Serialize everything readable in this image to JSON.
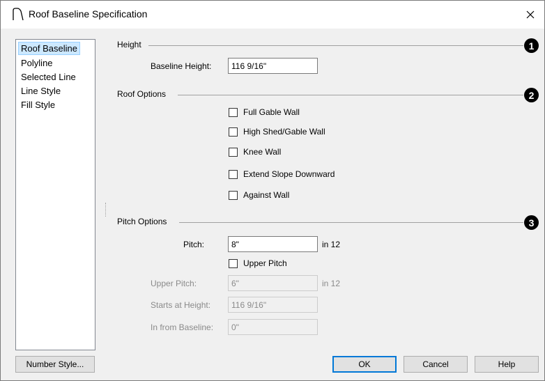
{
  "window": {
    "title": "Roof Baseline Specification"
  },
  "nav": {
    "items": [
      {
        "label": "Roof Baseline",
        "selected": true
      },
      {
        "label": "Polyline",
        "selected": false
      },
      {
        "label": "Selected Line",
        "selected": false
      },
      {
        "label": "Line Style",
        "selected": false
      },
      {
        "label": "Fill Style",
        "selected": false
      }
    ]
  },
  "height": {
    "group_label": "Height",
    "callout": "1",
    "baseline_height_label": "Baseline Height:",
    "baseline_height_value": "116 9/16\""
  },
  "roof_options": {
    "group_label": "Roof Options",
    "callout": "2",
    "checkboxes": [
      {
        "label": "Full Gable Wall",
        "checked": false
      },
      {
        "label": "High Shed/Gable Wall",
        "checked": false
      },
      {
        "label": "Knee Wall",
        "checked": false
      },
      {
        "label": "Extend Slope Downward",
        "checked": false
      },
      {
        "label": "Against Wall",
        "checked": false
      }
    ]
  },
  "pitch_options": {
    "group_label": "Pitch Options",
    "callout": "3",
    "pitch_label": "Pitch:",
    "pitch_value": "8\"",
    "pitch_unit": "in 12",
    "upper_pitch_checkbox_label": "Upper Pitch",
    "upper_pitch_checked": false,
    "upper_pitch_label": "Upper Pitch:",
    "upper_pitch_value": "6\"",
    "upper_pitch_unit": "in 12",
    "starts_at_height_label": "Starts at Height:",
    "starts_at_height_value": "116 9/16\"",
    "in_from_baseline_label": "In from Baseline:",
    "in_from_baseline_value": "0\""
  },
  "buttons": {
    "number_style": "Number Style...",
    "ok": "OK",
    "cancel": "Cancel",
    "help": "Help"
  },
  "colors": {
    "selection_bg": "#cce8ff",
    "default_button_border": "#0078d7",
    "disabled_text": "#8a8a8a"
  }
}
